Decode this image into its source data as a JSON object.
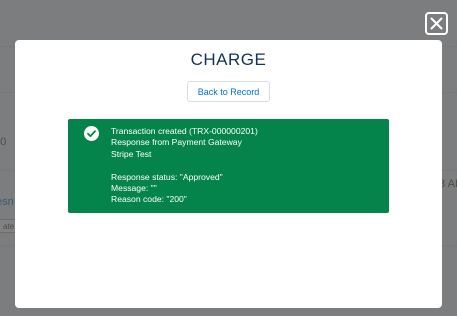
{
  "modal": {
    "title": "CHARGE",
    "back_button_label": "Back to Record"
  },
  "alert": {
    "status": "success",
    "icon": "check-circle-icon",
    "lines": [
      "Transaction created (TRX-000000201)",
      "Response from Payment Gateway",
      "Stripe Test",
      "",
      "Response status: \"Approved\"",
      "Message: \"\"",
      "Reason code: \"200\""
    ]
  },
  "close_button": {
    "icon": "close-icon"
  },
  "colors": {
    "success": "#04844b",
    "accent": "#0070d2",
    "title": "#16325c"
  }
}
